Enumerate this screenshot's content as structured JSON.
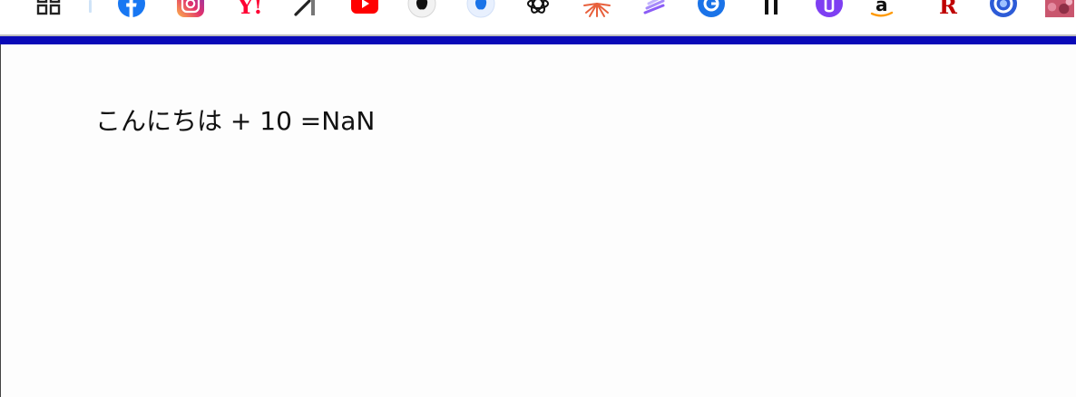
{
  "bookmarks_bar": {
    "items": [
      {
        "icon": "apps-grid-icon"
      },
      {
        "icon": "facebook-icon",
        "color": "#1877f2"
      },
      {
        "icon": "instagram-icon",
        "color": "#e1306c"
      },
      {
        "icon": "yahoo-icon",
        "color": "#ff0033"
      },
      {
        "icon": "arrow-tool-icon",
        "color": "#222222"
      },
      {
        "icon": "youtube-icon",
        "color": "#ff0000"
      },
      {
        "icon": "apple-icon",
        "color": "#111111"
      },
      {
        "icon": "apple-blue-icon",
        "color": "#1a73e8"
      },
      {
        "icon": "openai-icon",
        "color": "#111111"
      },
      {
        "icon": "starburst-icon",
        "color": "#e8603c"
      },
      {
        "icon": "stripes-icon",
        "color": "#8b5cf6"
      },
      {
        "icon": "blue-g-icon",
        "color": "#1a73e8"
      },
      {
        "icon": "double-quote-icon",
        "color": "#111111"
      },
      {
        "icon": "purple-circle-icon",
        "color": "#7e3ff2"
      },
      {
        "icon": "amazon-icon",
        "color": "#ff9900"
      },
      {
        "icon": "rakuten-icon",
        "color": "#bf0000"
      },
      {
        "icon": "blue-ring-icon",
        "color": "#2d5bd7"
      },
      {
        "icon": "image-thumbnail-icon",
        "color": "#c9566e"
      }
    ]
  },
  "page": {
    "accent_color": "#0a0ab8",
    "output_text": "こんにちは + 10 =NaN"
  }
}
